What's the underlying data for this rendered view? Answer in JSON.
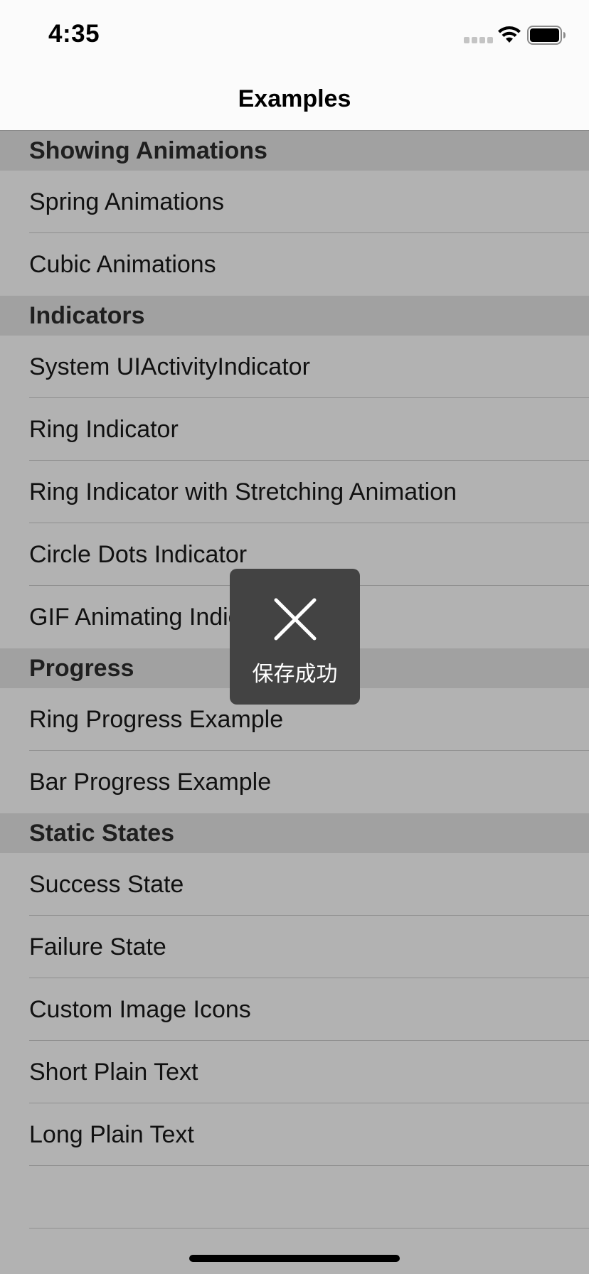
{
  "status_bar": {
    "time": "4:35"
  },
  "nav": {
    "title": "Examples"
  },
  "sections": [
    {
      "header": "Showing Animations",
      "rows": [
        "Spring Animations",
        "Cubic Animations"
      ]
    },
    {
      "header": "Indicators",
      "rows": [
        "System UIActivityIndicator",
        "Ring Indicator",
        "Ring Indicator with Stretching Animation",
        "Circle Dots Indicator",
        "GIF Animating Indic"
      ]
    },
    {
      "header": "Progress",
      "rows": [
        "Ring Progress Example",
        "Bar Progress Example"
      ]
    },
    {
      "header": "Static States",
      "rows": [
        "Success State",
        "Failure State",
        "Custom Image Icons",
        "Short Plain Text",
        "Long Plain Text"
      ]
    }
  ],
  "hud": {
    "icon": "close-icon",
    "label": "保存成功"
  },
  "colors": {
    "overlay_background": "#b2b2b2",
    "section_header": "#a1a1a1",
    "hud_background": "#434343"
  }
}
